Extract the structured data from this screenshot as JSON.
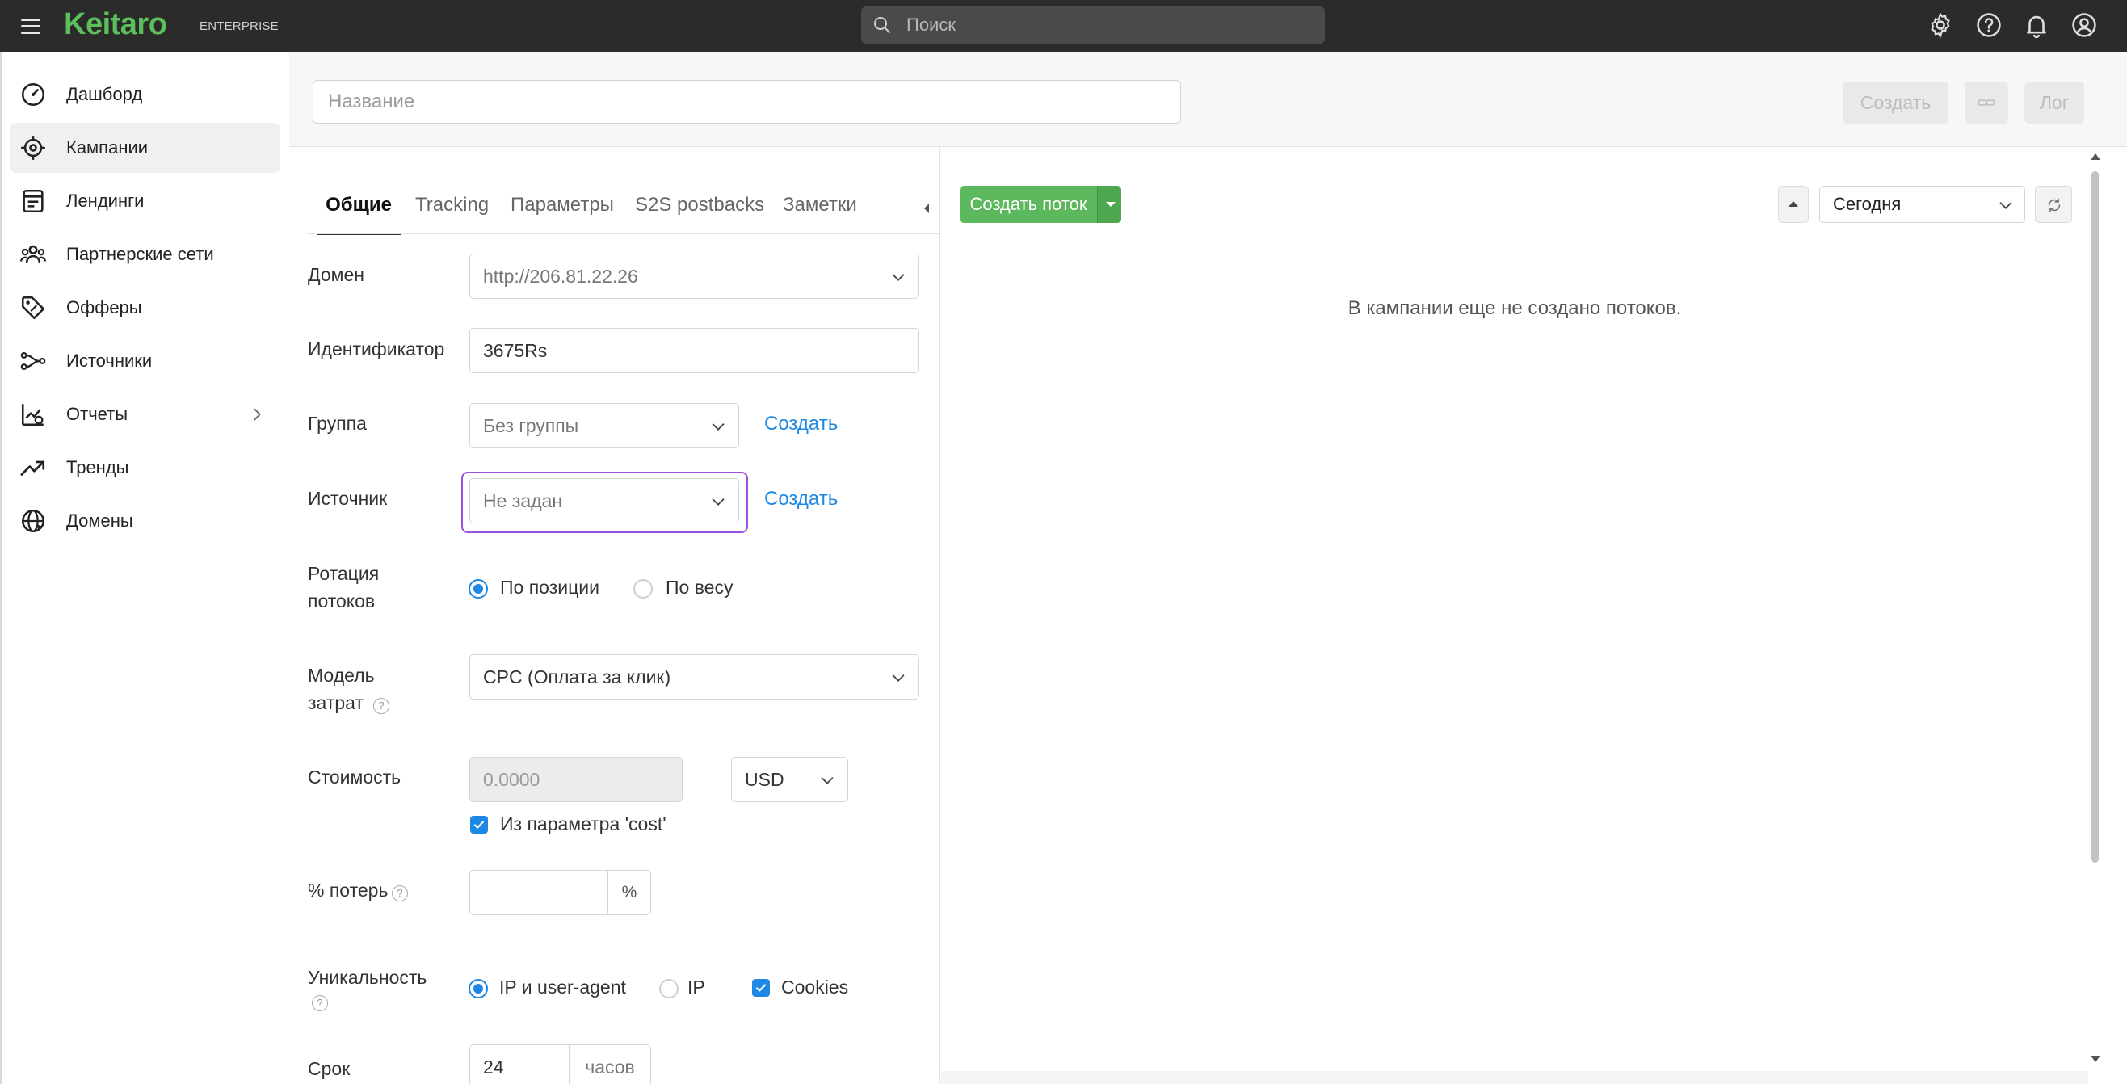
{
  "app": {
    "brand": "Keitaro",
    "edition": "ENTERPRISE"
  },
  "search": {
    "placeholder": "Поиск"
  },
  "topbar_icons": [
    "gear-icon",
    "help-icon",
    "bell-icon",
    "user-icon"
  ],
  "sidebar": {
    "items": [
      {
        "label": "Дашборд",
        "icon": "dashboard-icon"
      },
      {
        "label": "Кампании",
        "icon": "campaigns-icon",
        "active": true
      },
      {
        "label": "Лендинги",
        "icon": "landings-icon"
      },
      {
        "label": "Партнерские сети",
        "icon": "affiliate-networks-icon"
      },
      {
        "label": "Офферы",
        "icon": "offers-icon"
      },
      {
        "label": "Источники",
        "icon": "sources-icon"
      },
      {
        "label": "Отчеты",
        "icon": "reports-icon",
        "has_submenu": true
      },
      {
        "label": "Тренды",
        "icon": "trends-icon"
      },
      {
        "label": "Домены",
        "icon": "domains-icon"
      }
    ]
  },
  "header": {
    "name_placeholder": "Название",
    "create_label": "Создать",
    "log_label": "Лог"
  },
  "tabs": [
    {
      "label": "Общие",
      "active": true
    },
    {
      "label": "Tracking"
    },
    {
      "label": "Параметры"
    },
    {
      "label": "S2S postbacks"
    },
    {
      "label": "Заметки"
    }
  ],
  "form": {
    "domain": {
      "label": "Домен",
      "value": "http://206.81.22.26"
    },
    "identifier": {
      "label": "Идентификатор",
      "value": "3675Rs"
    },
    "group": {
      "label": "Группа",
      "value": "Без группы",
      "create_link": "Создать"
    },
    "source": {
      "label": "Источник",
      "value": "Не задан",
      "create_link": "Создать"
    },
    "rotation": {
      "label_line1": "Ротация",
      "label_line2": "потоков",
      "options": [
        "По позиции",
        "По весу"
      ],
      "selected": "По позиции"
    },
    "cost_model": {
      "label_line1": "Модель",
      "label_line2": "затрат",
      "value": "CPC (Оплата за клик)"
    },
    "cost": {
      "label": "Стоимость",
      "placeholder": "0.0000",
      "currency": "USD",
      "from_param_label": "Из параметра 'cost'",
      "from_param_checked": true
    },
    "loss": {
      "label": "% потерь",
      "suffix": "%"
    },
    "uniqueness": {
      "label": "Уникальность",
      "options": [
        "IP и user-agent",
        "IP"
      ],
      "selected": "IP и user-agent",
      "cookies_label": "Cookies",
      "cookies_checked": true
    },
    "term": {
      "label": "Срок",
      "value": "24",
      "suffix": "часов"
    }
  },
  "streams": {
    "create_button": "Создать поток",
    "period": "Сегодня",
    "empty_message": "В кампании еще не создано потоков."
  },
  "colors": {
    "brand_green": "#5cbf5c",
    "accent_blue": "#1e88e5",
    "focus_purple": "#9b51e0",
    "topbar": "#2b2b2b"
  }
}
